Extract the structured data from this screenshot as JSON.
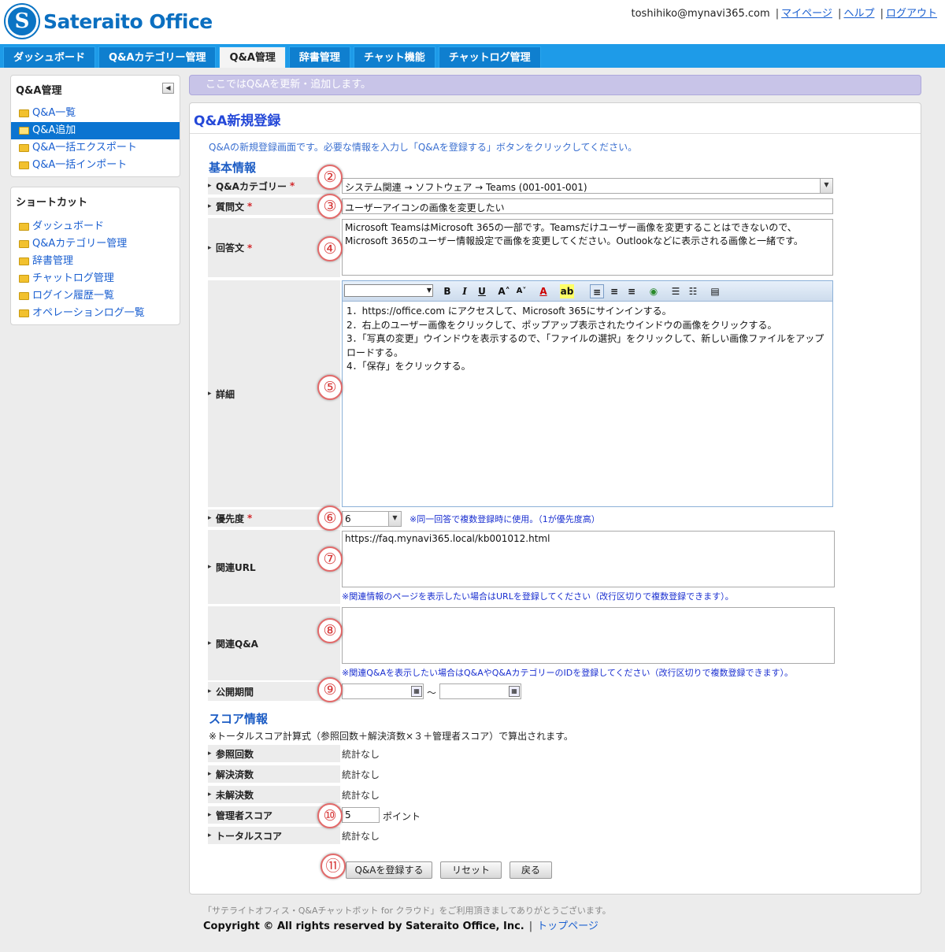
{
  "header": {
    "logo_letter": "S",
    "logo_text": "Sateraito Office",
    "user_email": "toshihiko@mynavi365.com",
    "links": [
      "マイページ",
      "ヘルプ",
      "ログアウト"
    ]
  },
  "nav": {
    "tabs": [
      "ダッシュボード",
      "Q&Aカテゴリー管理",
      "Q&A管理",
      "辞書管理",
      "チャット機能",
      "チャットログ管理"
    ],
    "active_index": 2
  },
  "sidebar": {
    "qa_box": {
      "title": "Q&A管理",
      "items": [
        "Q&A一覧",
        "Q&A追加",
        "Q&A一括エクスポート",
        "Q&A一括インポート"
      ],
      "active_index": 1
    },
    "shortcut_box": {
      "title": "ショートカット",
      "items": [
        "ダッシュボード",
        "Q&Aカテゴリー管理",
        "辞書管理",
        "チャットログ管理",
        "ログイン履歴一覧",
        "オペレーションログ一覧"
      ]
    }
  },
  "message_bar": "ここではQ&Aを更新・追加します。",
  "panel": {
    "title": "Q&A新規登録",
    "description": "Q&Aの新規登録画面です。必要な情報を入力し「Q&Aを登録する」ボタンをクリックしてください。"
  },
  "basic": {
    "section_title": "基本情報",
    "category_label": "Q&Aカテゴリー",
    "category_value": "システム関連 → ソフトウェア → Teams (001-001-001)",
    "question_label": "質問文",
    "question_value": "ユーザーアイコンの画像を変更したい",
    "answer_label": "回答文",
    "answer_value": "Microsoft TeamsはMicrosoft 365の一部です。Teamsだけユーザー画像を変更することはできないので、Microsoft 365のユーザー情報設定で画像を変更してください。Outlookなどに表示される画像と一緒です。",
    "detail_label": "詳細",
    "detail_lines": [
      "1．https://office.com にアクセスして、Microsoft 365にサインインする。",
      "2．右上のユーザー画像をクリックして、ポップアップ表示されたウインドウの画像をクリックする。",
      "3．「写真の変更」ウインドウを表示するので、「ファイルの選択」をクリックして、新しい画像ファイルをアップロードする。",
      "4．「保存」をクリックする。"
    ],
    "priority_label": "優先度",
    "priority_value": "6",
    "priority_note": "※同一回答で複数登録時に使用。（1が優先度高）",
    "url_label": "関連URL",
    "url_value": "https://faq.mynavi365.local/kb001012.html",
    "url_note": "※関連情報のページを表示したい場合はURLを登録してください（改行区切りで複数登録できます）。",
    "related_label": "関連Q&A",
    "related_value": "",
    "related_note": "※関連Q&Aを表示したい場合はQ&AやQ&AカテゴリーのIDを登録してください（改行区切りで複数登録できます）。",
    "period_label": "公開期間",
    "period_sep": "～"
  },
  "score": {
    "section_title": "スコア情報",
    "formula": "※トータルスコア計算式（参照回数＋解決済数×３＋管理者スコア）で算出されます。",
    "rows": [
      {
        "label": "参照回数",
        "value": "統計なし"
      },
      {
        "label": "解決済数",
        "value": "統計なし"
      },
      {
        "label": "未解決数",
        "value": "統計なし"
      }
    ],
    "admin_label": "管理者スコア",
    "admin_value": "5",
    "admin_unit": "ポイント",
    "total_label": "トータルスコア",
    "total_value": "統計なし"
  },
  "buttons": {
    "submit": "Q&Aを登録する",
    "reset": "リセット",
    "back": "戻る"
  },
  "markers": [
    "②",
    "③",
    "④",
    "⑤",
    "⑥",
    "⑦",
    "⑧",
    "⑨",
    "⑩",
    "⑪"
  ],
  "footer": {
    "note": "「サテライトオフィス・Q&Aチャットボット for クラウド」をご利用頂きましてありがとうございます。",
    "copyright": "Copyright © All rights reserved by Sateraito Office, Inc.",
    "top_link": "トップページ"
  },
  "colors": {
    "nav_bg": "#1e9be8",
    "accent_title": "#2448d8",
    "marker": "#d53333"
  }
}
